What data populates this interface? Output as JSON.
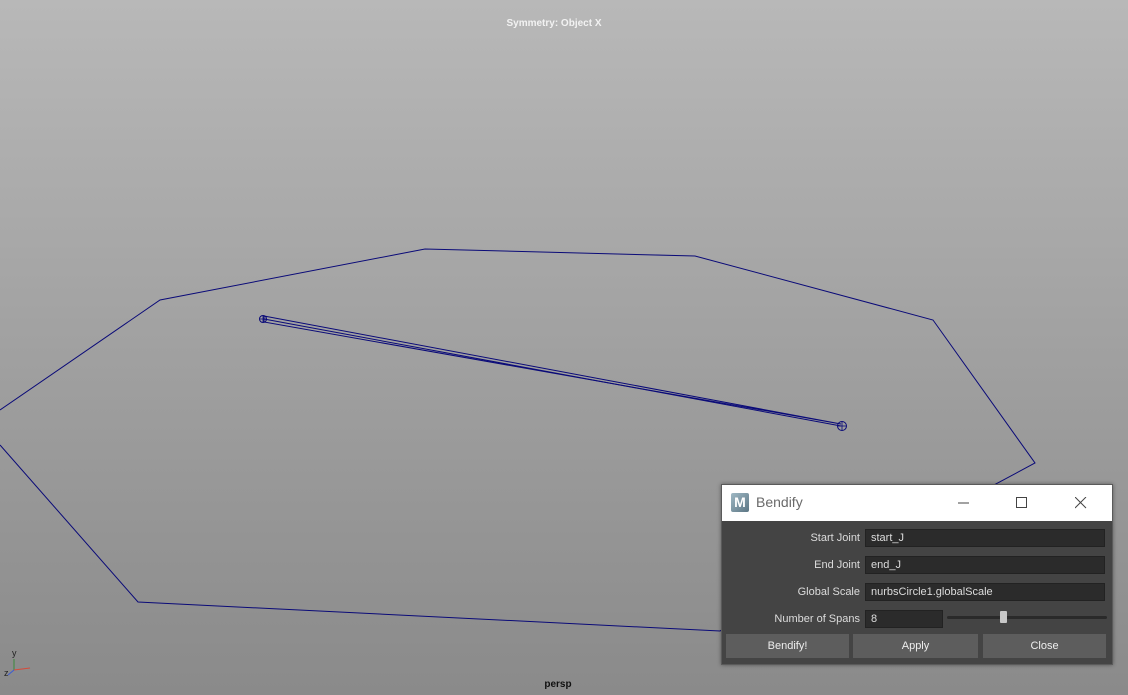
{
  "viewport": {
    "hud_top": "Symmetry: Object X",
    "camera_name": "persp",
    "axis_labels": {
      "y": "y",
      "z": "z"
    },
    "wire_color": "#0a0a78",
    "axis_colors": {
      "x": "#d64a3a",
      "y": "#3a8a3a",
      "z": "#3a5ad6"
    }
  },
  "dialog": {
    "app_icon_letter": "M",
    "title": "Bendify",
    "window_controls": [
      "minimize-icon",
      "maximize-icon",
      "close-icon"
    ],
    "fields": {
      "start_joint": {
        "label": "Start Joint",
        "value": "start_J"
      },
      "end_joint": {
        "label": "End Joint",
        "value": "end_J"
      },
      "global_scale": {
        "label": "Global Scale",
        "value": "nurbsCircle1.globalScale"
      },
      "num_spans": {
        "label": "Number of Spans",
        "value": "8"
      }
    },
    "spans_slider_fraction": 0.35,
    "buttons": {
      "bendify": "Bendify!",
      "apply": "Apply",
      "close": "Close"
    }
  }
}
